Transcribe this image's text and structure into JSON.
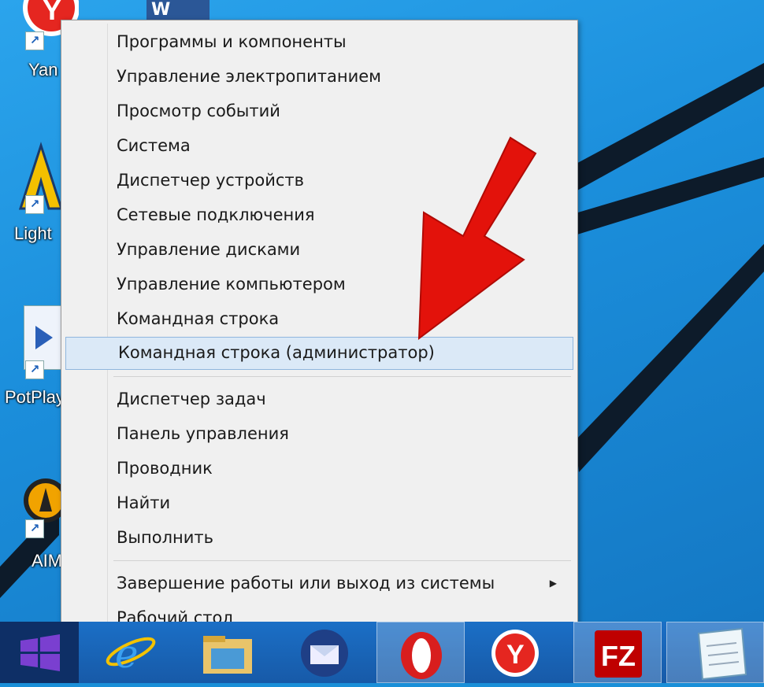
{
  "desktop": {
    "icons": [
      {
        "name": "yandex-browser",
        "label": "Yan"
      },
      {
        "name": "lightworks",
        "label": "Light"
      },
      {
        "name": "potplayer",
        "label": "PotPlay"
      },
      {
        "name": "aimp",
        "label": "AIM"
      }
    ],
    "word_icon_text": "W"
  },
  "context_menu": {
    "items_group1": [
      "Программы и компоненты",
      "Управление электропитанием",
      "Просмотр событий",
      "Система",
      "Диспетчер устройств",
      "Сетевые подключения",
      "Управление дисками",
      "Управление компьютером",
      "Командная строка",
      "Командная строка (администратор)"
    ],
    "items_group2": [
      "Диспетчер задач",
      "Панель управления",
      "Проводник",
      "Найти",
      "Выполнить"
    ],
    "items_group3": [
      "Завершение работы или выход из системы",
      "Рабочий стол"
    ],
    "selected_index": 9,
    "submenu_arrow": "▶"
  },
  "taskbar": {
    "buttons": [
      "start",
      "internet-explorer",
      "file-explorer",
      "thunderbird",
      "opera",
      "yandex-browser",
      "filezilla",
      "notepad"
    ],
    "filezilla_text": "FZ",
    "ie_text": "e"
  },
  "colors": {
    "desktop_blue": "#1b8edb",
    "menu_bg": "#f0f0f0",
    "selected_bg": "#dbe9f7",
    "arrow_red": "#e3120b",
    "start_purple": "#6b2fb8"
  }
}
